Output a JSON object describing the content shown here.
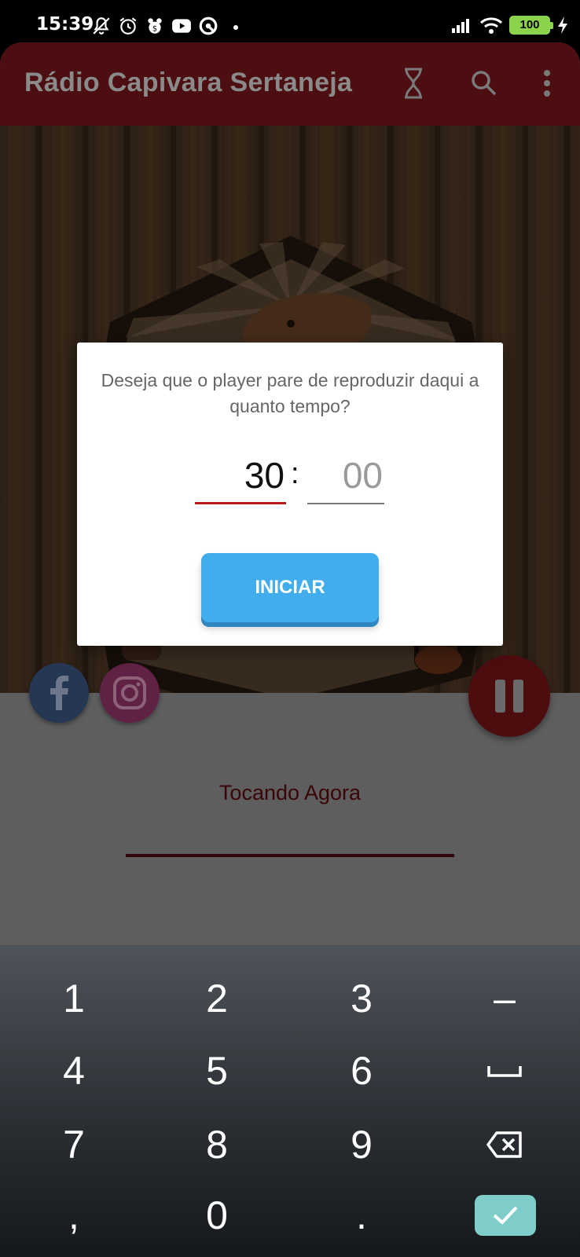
{
  "status_bar": {
    "time": "15:39",
    "battery": "100"
  },
  "app": {
    "title": "Rádio Capivara Sertaneja",
    "toolbar_icons": [
      "hourglass-icon",
      "search-icon",
      "more-vert-icon"
    ]
  },
  "player": {
    "now_playing_label": "Tocando Agora",
    "social": [
      "facebook-icon",
      "instagram-icon"
    ]
  },
  "dialog": {
    "message": "Deseja que o player pare de reproduzir daqui a quanto tempo?",
    "minutes": "30",
    "separator": ":",
    "seconds": "00",
    "start_button": "INICIAR"
  },
  "keyboard": {
    "rows": [
      [
        "1",
        "2",
        "3",
        "–"
      ],
      [
        "4",
        "5",
        "6",
        "space"
      ],
      [
        "7",
        "8",
        "9",
        "backspace"
      ],
      [
        ",",
        "0",
        ".",
        "done"
      ]
    ]
  },
  "colors": {
    "toolbar": "#4c0e10",
    "accent_red": "#b71c1c",
    "button_blue": "#42aded",
    "keyboard_ok": "#7fcdc9"
  }
}
